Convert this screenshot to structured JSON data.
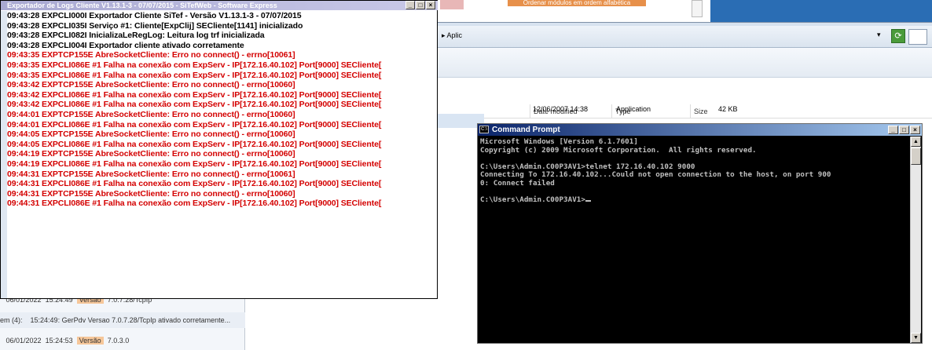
{
  "top": {
    "orange_button": "Ordenar módulos em ordem alfabética"
  },
  "explorer": {
    "address_path": "▸ Aplic",
    "columns": [
      "Date modified",
      "Type",
      "Size"
    ],
    "row": {
      "date": "12/06/2007 14:38",
      "type": "Application",
      "size": "42 KB"
    }
  },
  "left_list": {
    "row1": {
      "date": "06/01/2022",
      "time": "15:24:49",
      "badge": "Versão",
      "value": "7.0.7.28/TcpIp"
    },
    "row2": {
      "prefix": "em (4):",
      "text": "15:24:49: GerPdv Versao 7.0.7.28/TcpIp ativado corretamente..."
    },
    "row3": {
      "date": "06/01/2022",
      "time": "15:24:53",
      "badge": "Versão",
      "value": "7.0.3.0"
    }
  },
  "logwin": {
    "title": "Exportador de Logs Cliente V1.13.1-3 - 07/07/2015 - SiTefWeb - Software Express",
    "lines": [
      {
        "text": "09:43:28  EXPCLI000I Exportador Cliente SiTef - Versão V1.13.1-3 - 07/07/2015",
        "color": "black"
      },
      {
        "text": "09:43:28  EXPCLI035I Serviço #1: Cliente[ExpClij] SECliente[1141] inicializado",
        "color": "black"
      },
      {
        "text": "09:43:28  EXPCLI082I InicializaLeRegLog: Leitura log trf inicializada",
        "color": "black"
      },
      {
        "text": "09:43:28  EXPCLI004I Exportador cliente ativado corretamente",
        "color": "black"
      },
      {
        "text": "09:43:35  EXPTCP155E AbreSocketCliente: Erro no connect() - errno[10061]",
        "color": "red"
      },
      {
        "text": "09:43:35  EXPCLI086E #1 Falha na conexão com ExpServ - IP[172.16.40.102] Port[9000] SECliente[",
        "color": "red"
      },
      {
        "text": "09:43:35  EXPCLI086E #1 Falha na conexão com ExpServ - IP[172.16.40.102] Port[9000] SECliente[",
        "color": "red"
      },
      {
        "text": "09:43:42  EXPTCP155E AbreSocketCliente: Erro no connect() - errno[10060]",
        "color": "red"
      },
      {
        "text": "09:43:42  EXPCLI086E #1 Falha na conexão com ExpServ - IP[172.16.40.102] Port[9000] SECliente[",
        "color": "red"
      },
      {
        "text": "09:43:42  EXPCLI086E #1 Falha na conexão com ExpServ - IP[172.16.40.102] Port[9000] SECliente[",
        "color": "red"
      },
      {
        "text": "09:44:01  EXPTCP155E AbreSocketCliente: Erro no connect() - errno[10060]",
        "color": "red"
      },
      {
        "text": "09:44:01  EXPCLI086E #1 Falha na conexão com ExpServ - IP[172.16.40.102] Port[9000] SECliente[",
        "color": "red"
      },
      {
        "text": "09:44:05  EXPTCP155E AbreSocketCliente: Erro no connect() - errno[10060]",
        "color": "red"
      },
      {
        "text": "09:44:05  EXPCLI086E #1 Falha na conexão com ExpServ - IP[172.16.40.102] Port[9000] SECliente[",
        "color": "red"
      },
      {
        "text": "09:44:19  EXPTCP155E AbreSocketCliente: Erro no connect() - errno[10060]",
        "color": "red"
      },
      {
        "text": "09:44:19  EXPCLI086E #1 Falha na conexão com ExpServ - IP[172.16.40.102] Port[9000] SECliente[",
        "color": "red"
      },
      {
        "text": "09:44:31  EXPTCP155E AbreSocketCliente: Erro no connect() - errno[10061]",
        "color": "red"
      },
      {
        "text": "09:44:31  EXPCLI086E #1 Falha na conexão com ExpServ - IP[172.16.40.102] Port[9000] SECliente[",
        "color": "red"
      },
      {
        "text": "09:44:31  EXPTCP155E AbreSocketCliente: Erro no connect() - errno[10060]",
        "color": "red"
      },
      {
        "text": "09:44:31  EXPCLI086E #1 Falha na conexão com ExpServ - IP[172.16.40.102] Port[9000] SECliente[",
        "color": "red"
      }
    ]
  },
  "cmd": {
    "title": "Command Prompt",
    "lines": [
      "Microsoft Windows [Version 6.1.7601]",
      "Copyright (c) 2009 Microsoft Corporation.  All rights reserved.",
      "",
      "C:\\Users\\Admin.C00P3AV1>telnet 172.16.40.102 9000",
      "Connecting To 172.16.40.102...Could not open connection to the host, on port 900",
      "0: Connect failed",
      "",
      "C:\\Users\\Admin.C00P3AV1>"
    ]
  },
  "colors": {
    "log_red": "#d40000",
    "cmd_bg": "#000000",
    "cmd_text": "#c0c0c0",
    "cmd_title": "#0a246a"
  }
}
